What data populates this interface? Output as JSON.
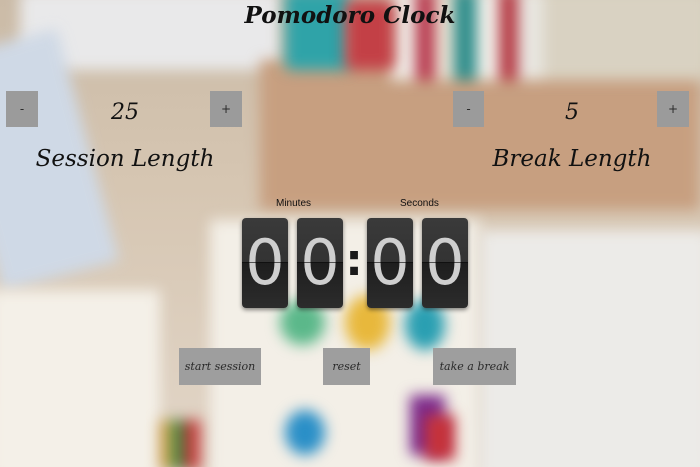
{
  "app": {
    "title": "Pomodoro Clock"
  },
  "session": {
    "decrement_label": "-",
    "increment_label": "+",
    "value": "25",
    "label": "Session Length"
  },
  "break": {
    "decrement_label": "-",
    "increment_label": "+",
    "value": "5",
    "label": "Break Length"
  },
  "timer": {
    "minutes_label": "Minutes",
    "seconds_label": "Seconds",
    "minutes_tens": "0",
    "minutes_ones": "0",
    "separator": ":",
    "seconds_tens": "0",
    "seconds_ones": "0"
  },
  "actions": {
    "start_label": "start session",
    "reset_label": "reset",
    "break_label": "take a break"
  },
  "colors": {
    "button_bg": "#9e9e9e",
    "digit_bg": "#333333",
    "digit_text": "#cfcfcf"
  }
}
